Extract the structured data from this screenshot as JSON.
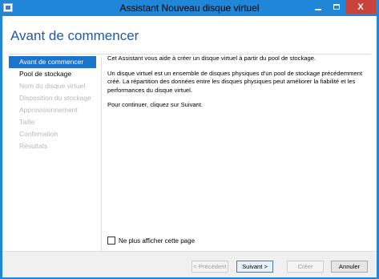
{
  "window": {
    "title": "Assistant Nouveau disque virtuel",
    "controls": {
      "minimize": "",
      "maximize": "",
      "close": "X"
    }
  },
  "header": {
    "title": "Avant de commencer"
  },
  "nav": {
    "items": [
      {
        "label": "Avant de commencer",
        "state": "active"
      },
      {
        "label": "Pool de stockage",
        "state": "enabled"
      },
      {
        "label": "Nom du disque virtuel",
        "state": "disabled"
      },
      {
        "label": "Disposition du stockage",
        "state": "disabled"
      },
      {
        "label": "Approvisionnement",
        "state": "disabled"
      },
      {
        "label": "Taille",
        "state": "disabled"
      },
      {
        "label": "Confirmation",
        "state": "disabled"
      },
      {
        "label": "Résultats",
        "state": "disabled"
      }
    ]
  },
  "content": {
    "p1": "Cet Assistant vous aide à créer un disque virtuel à partir du pool de stockage.",
    "p2": "Un disque virtuel est un ensemble de disques physiques d'un pool de stockage précédemment créé. La répartition des données entre les disques physiques peut améliorer la fiabilité et les performances du disque virtuel.",
    "p3": "Pour continuer, cliquez sur Suivant."
  },
  "checkbox": {
    "label": "Ne plus afficher cette page",
    "checked": false
  },
  "footer": {
    "previous": "< Précédent",
    "next": "Suivant >",
    "create": "Créer",
    "cancel": "Annuler"
  },
  "colors": {
    "titlebar": "#1f86d8",
    "accent": "#1b74c9",
    "close": "#c7433b"
  }
}
